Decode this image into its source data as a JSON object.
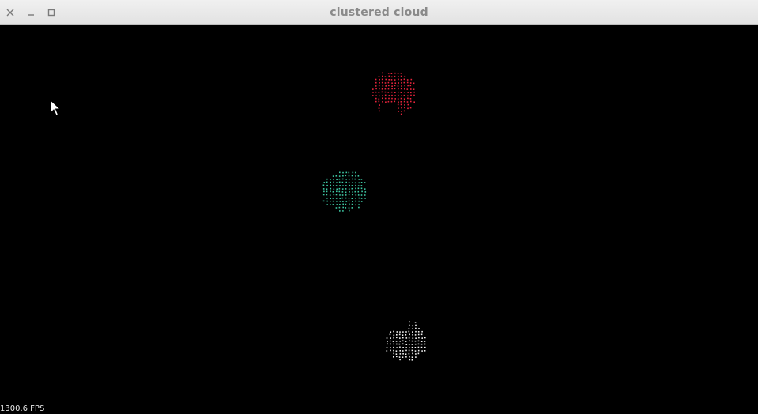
{
  "window": {
    "title": "clustered cloud",
    "controls": [
      {
        "name": "close-button",
        "icon": "close-icon"
      },
      {
        "name": "minimize-button",
        "icon": "minimize-icon"
      },
      {
        "name": "maximize-button",
        "icon": "maximize-icon"
      }
    ]
  },
  "viewport": {
    "background": "#000000",
    "fps_text": "1300.6 FPS"
  },
  "clusters": [
    {
      "name": "red-cluster",
      "color": "#e8243c"
    },
    {
      "name": "teal-cluster",
      "color": "#3ec9a4"
    },
    {
      "name": "white-cluster",
      "color": "#f2f2f2"
    }
  ],
  "cursor": {
    "icon": "mouse-pointer-icon"
  }
}
